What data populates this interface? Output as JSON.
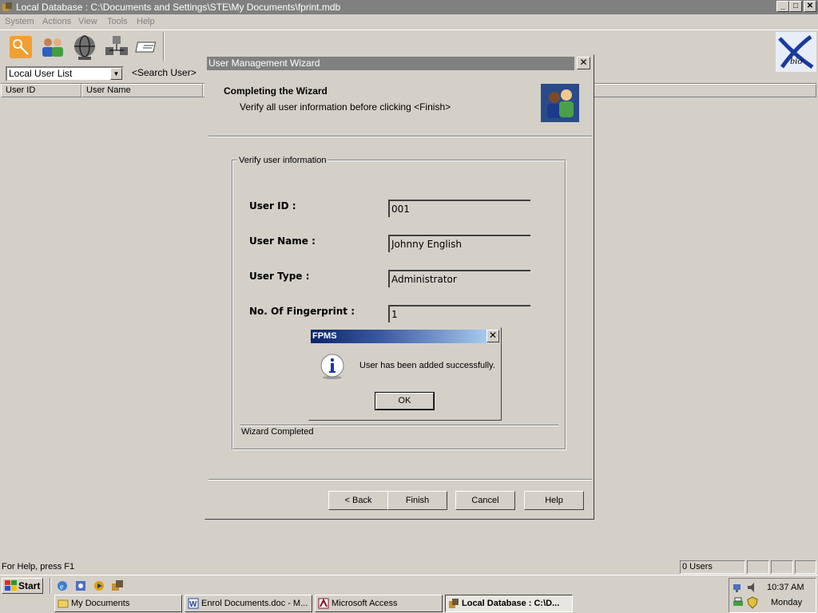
{
  "window": {
    "title": "Local Database : C:\\Documents and Settings\\STE\\My Documents\\fprint.mdb",
    "min": "_",
    "max": "□",
    "close": "✕"
  },
  "menubar": {
    "items": [
      "System",
      "Actions",
      "View",
      "Tools",
      "Help"
    ]
  },
  "toolbar": {
    "icons": [
      "key-icon",
      "users-icon",
      "globe-icon",
      "network-icon",
      "card-icon"
    ]
  },
  "list": {
    "combo_value": "Local User List",
    "search_label": "<Search User>",
    "columns": [
      "User ID",
      "User Name"
    ]
  },
  "statusbar": {
    "help_text": "For Help, press F1",
    "user_count": "0 Users"
  },
  "wizard": {
    "title": "User Management Wizard",
    "close": "✕",
    "heading": "Completing the Wizard",
    "subheading": "Verify all user information before clicking <Finish>",
    "group_label": "Verify user information",
    "fields": [
      {
        "label": "User ID :",
        "value": "001"
      },
      {
        "label": "User Name :",
        "value": "Johnny English"
      },
      {
        "label": "User Type :",
        "value": "Administrator"
      },
      {
        "label": "No. Of Fingerprint :",
        "value": "1"
      }
    ],
    "complete_text": "Wizard Completed",
    "buttons": {
      "back": "< Back",
      "finish": "Finish",
      "cancel": "Cancel",
      "help": "Help"
    }
  },
  "msgbox": {
    "title": "FPMS",
    "close": "✕",
    "message": "User has been added successfully.",
    "ok": "OK",
    "icon": "info-icon"
  },
  "taskbar": {
    "start": "Start",
    "quicklaunch": [
      "ie-icon",
      "outlook-icon",
      "media-player-icon",
      "fprint-icon"
    ],
    "tasks": [
      {
        "label": "My Documents",
        "icon": "folder-icon"
      },
      {
        "label": "Enrol Documents.doc - M...",
        "icon": "word-icon"
      },
      {
        "label": "Microsoft Access",
        "icon": "access-icon"
      },
      {
        "label": "Local Database : C:\\D...",
        "icon": "fprint-icon"
      }
    ],
    "clock": "10:37 AM",
    "day": "Monday"
  },
  "brand": {
    "logo_text": "bio"
  }
}
